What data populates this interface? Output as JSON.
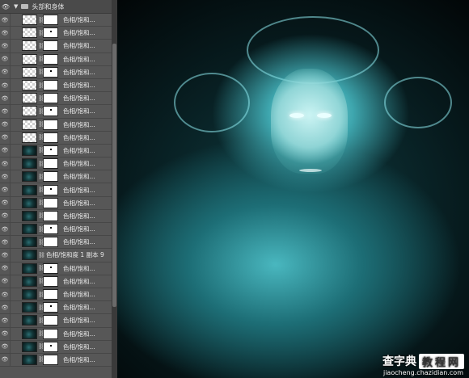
{
  "layers_panel": {
    "group": {
      "name": "头部和身体"
    },
    "layers": [
      {
        "label": "色相/饱和...",
        "thumb": "checker",
        "mask": "white"
      },
      {
        "label": "色相/饱和...",
        "thumb": "checker",
        "mask": "white"
      },
      {
        "label": "色相/饱和...",
        "thumb": "checker",
        "mask": "white"
      },
      {
        "label": "色相/饱和...",
        "thumb": "checker",
        "mask": "white"
      },
      {
        "label": "色相/饱和...",
        "thumb": "checker",
        "mask": "white"
      },
      {
        "label": "色相/饱和...",
        "thumb": "checker",
        "mask": "white"
      },
      {
        "label": "色相/饱和...",
        "thumb": "checker",
        "mask": "white"
      },
      {
        "label": "色相/饱和...",
        "thumb": "checker",
        "mask": "white"
      },
      {
        "label": "色相/饱和...",
        "thumb": "checker",
        "mask": "white"
      },
      {
        "label": "色相/饱和...",
        "thumb": "checker",
        "mask": "white"
      },
      {
        "label": "色相/饱和...",
        "thumb": "dark",
        "mask": "white"
      },
      {
        "label": "色相/饱和...",
        "thumb": "dark",
        "mask": "white"
      },
      {
        "label": "色相/饱和...",
        "thumb": "dark",
        "mask": "white"
      },
      {
        "label": "色相/饱和...",
        "thumb": "dark",
        "mask": "white"
      },
      {
        "label": "色相/饱和...",
        "thumb": "dark",
        "mask": "white"
      },
      {
        "label": "色相/饱和...",
        "thumb": "dark",
        "mask": "white"
      },
      {
        "label": "色相/饱和...",
        "thumb": "dark",
        "mask": "white"
      },
      {
        "label": "色相/饱和...",
        "thumb": "dark",
        "mask": "white"
      },
      {
        "label": "色相/饱和度 1 副本 9",
        "thumb": "dark",
        "mask": "none"
      },
      {
        "label": "色相/饱和...",
        "thumb": "dark",
        "mask": "white"
      },
      {
        "label": "色相/饱和...",
        "thumb": "dark",
        "mask": "white"
      },
      {
        "label": "色相/饱和...",
        "thumb": "dark",
        "mask": "white"
      },
      {
        "label": "色相/饱和...",
        "thumb": "dark",
        "mask": "white"
      },
      {
        "label": "色相/饱和...",
        "thumb": "dark",
        "mask": "white"
      },
      {
        "label": "色相/饱和...",
        "thumb": "dark",
        "mask": "white"
      },
      {
        "label": "色相/饱和...",
        "thumb": "dark",
        "mask": "white"
      },
      {
        "label": "色相/饱和...",
        "thumb": "dark",
        "mask": "white"
      }
    ]
  },
  "watermark": {
    "brand": "查字典",
    "boxed": "教程网",
    "url": "jiaocheng.chazidian.com"
  }
}
